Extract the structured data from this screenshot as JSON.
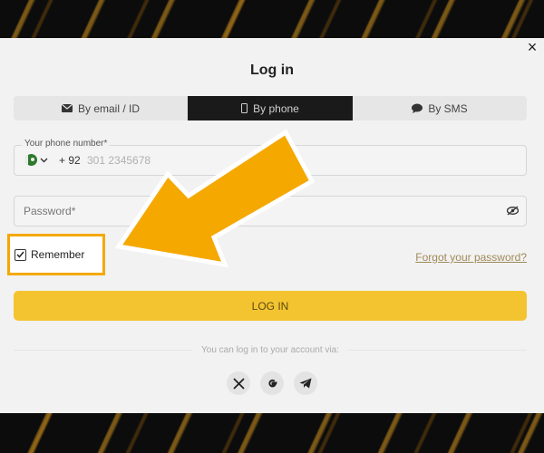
{
  "modal": {
    "close_glyph": "×",
    "title": "Log in"
  },
  "tabs": [
    {
      "label": "By email / ID",
      "icon": "envelope-icon"
    },
    {
      "label": "By phone",
      "icon": "phone-icon",
      "active": true
    },
    {
      "label": "By SMS",
      "icon": "chat-bubble-icon"
    }
  ],
  "phone": {
    "label": "Your phone number*",
    "country_code": "+ 92",
    "placeholder": "301 2345678"
  },
  "password": {
    "placeholder": "Password*"
  },
  "remember": {
    "label": "Remember",
    "checked": true
  },
  "forgot_link": "Forgot your password?",
  "login_button": "LOG IN",
  "social": {
    "caption": "You can log in to your account via:",
    "providers": [
      "x-icon",
      "google-icon",
      "telegram-icon"
    ]
  },
  "colors": {
    "accent": "#f4c430",
    "highlight_border": "#f5a800",
    "arrow": "#f5a800"
  }
}
